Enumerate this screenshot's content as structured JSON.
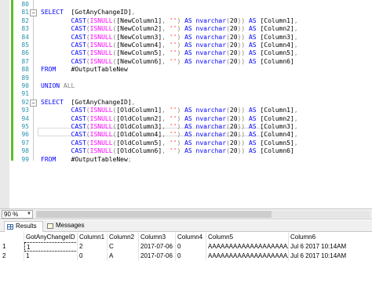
{
  "editor": {
    "lines": [
      {
        "num": "80",
        "tokens": [
          {
            "t": "",
            "c": "tx"
          }
        ]
      },
      {
        "num": "81",
        "tokens": [
          {
            "t": "SELECT  ",
            "c": "kw"
          },
          {
            "t": "[GotAnyChangeID]",
            "c": "tx"
          },
          {
            "t": ",",
            "c": "gr"
          }
        ]
      },
      {
        "num": "82",
        "tokens": [
          {
            "t": "        ",
            "c": "tx"
          },
          {
            "t": "CAST",
            "c": "kw"
          },
          {
            "t": "(",
            "c": "gr"
          },
          {
            "t": "ISNULL",
            "c": "fn"
          },
          {
            "t": "(",
            "c": "gr"
          },
          {
            "t": "[NewColumn1]",
            "c": "tx"
          },
          {
            "t": ", ",
            "c": "gr"
          },
          {
            "t": "''",
            "c": "str"
          },
          {
            "t": ") ",
            "c": "gr"
          },
          {
            "t": "AS nvarchar",
            "c": "kw"
          },
          {
            "t": "(",
            "c": "gr"
          },
          {
            "t": "20",
            "c": "tx"
          },
          {
            "t": ")) ",
            "c": "gr"
          },
          {
            "t": "AS ",
            "c": "kw"
          },
          {
            "t": "[Column1]",
            "c": "tx"
          },
          {
            "t": ",",
            "c": "gr"
          }
        ]
      },
      {
        "num": "83",
        "tokens": [
          {
            "t": "        ",
            "c": "tx"
          },
          {
            "t": "CAST",
            "c": "kw"
          },
          {
            "t": "(",
            "c": "gr"
          },
          {
            "t": "ISNULL",
            "c": "fn"
          },
          {
            "t": "(",
            "c": "gr"
          },
          {
            "t": "[NewColumn2]",
            "c": "tx"
          },
          {
            "t": ", ",
            "c": "gr"
          },
          {
            "t": "''",
            "c": "str"
          },
          {
            "t": ") ",
            "c": "gr"
          },
          {
            "t": "AS nvarchar",
            "c": "kw"
          },
          {
            "t": "(",
            "c": "gr"
          },
          {
            "t": "20",
            "c": "tx"
          },
          {
            "t": ")) ",
            "c": "gr"
          },
          {
            "t": "AS ",
            "c": "kw"
          },
          {
            "t": "[Column2]",
            "c": "tx"
          },
          {
            "t": ",",
            "c": "gr"
          }
        ]
      },
      {
        "num": "84",
        "tokens": [
          {
            "t": "        ",
            "c": "tx"
          },
          {
            "t": "CAST",
            "c": "kw"
          },
          {
            "t": "(",
            "c": "gr"
          },
          {
            "t": "ISNULL",
            "c": "fn"
          },
          {
            "t": "(",
            "c": "gr"
          },
          {
            "t": "[NewColumn3]",
            "c": "tx"
          },
          {
            "t": ", ",
            "c": "gr"
          },
          {
            "t": "''",
            "c": "str"
          },
          {
            "t": ") ",
            "c": "gr"
          },
          {
            "t": "AS nvarchar",
            "c": "kw"
          },
          {
            "t": "(",
            "c": "gr"
          },
          {
            "t": "20",
            "c": "tx"
          },
          {
            "t": ")) ",
            "c": "gr"
          },
          {
            "t": "AS ",
            "c": "kw"
          },
          {
            "t": "[Column3]",
            "c": "tx"
          },
          {
            "t": ",",
            "c": "gr"
          }
        ]
      },
      {
        "num": "85",
        "tokens": [
          {
            "t": "        ",
            "c": "tx"
          },
          {
            "t": "CAST",
            "c": "kw"
          },
          {
            "t": "(",
            "c": "gr"
          },
          {
            "t": "ISNULL",
            "c": "fn"
          },
          {
            "t": "(",
            "c": "gr"
          },
          {
            "t": "[NewColumn4]",
            "c": "tx"
          },
          {
            "t": ", ",
            "c": "gr"
          },
          {
            "t": "''",
            "c": "str"
          },
          {
            "t": ") ",
            "c": "gr"
          },
          {
            "t": "AS nvarchar",
            "c": "kw"
          },
          {
            "t": "(",
            "c": "gr"
          },
          {
            "t": "20",
            "c": "tx"
          },
          {
            "t": ")) ",
            "c": "gr"
          },
          {
            "t": "AS ",
            "c": "kw"
          },
          {
            "t": "[Column4]",
            "c": "tx"
          },
          {
            "t": ",",
            "c": "gr"
          }
        ]
      },
      {
        "num": "86",
        "tokens": [
          {
            "t": "        ",
            "c": "tx"
          },
          {
            "t": "CAST",
            "c": "kw"
          },
          {
            "t": "(",
            "c": "gr"
          },
          {
            "t": "ISNULL",
            "c": "fn"
          },
          {
            "t": "(",
            "c": "gr"
          },
          {
            "t": "[NewColumn5]",
            "c": "tx"
          },
          {
            "t": ", ",
            "c": "gr"
          },
          {
            "t": "''",
            "c": "str"
          },
          {
            "t": ") ",
            "c": "gr"
          },
          {
            "t": "AS nvarchar",
            "c": "kw"
          },
          {
            "t": "(",
            "c": "gr"
          },
          {
            "t": "20",
            "c": "tx"
          },
          {
            "t": ")) ",
            "c": "gr"
          },
          {
            "t": "AS ",
            "c": "kw"
          },
          {
            "t": "[Column5]",
            "c": "tx"
          },
          {
            "t": ",",
            "c": "gr"
          }
        ]
      },
      {
        "num": "87",
        "tokens": [
          {
            "t": "        ",
            "c": "tx"
          },
          {
            "t": "CAST",
            "c": "kw"
          },
          {
            "t": "(",
            "c": "gr"
          },
          {
            "t": "ISNULL",
            "c": "fn"
          },
          {
            "t": "(",
            "c": "gr"
          },
          {
            "t": "[NewColumn6]",
            "c": "tx"
          },
          {
            "t": ", ",
            "c": "gr"
          },
          {
            "t": "''",
            "c": "str"
          },
          {
            "t": ") ",
            "c": "gr"
          },
          {
            "t": "AS nvarchar",
            "c": "kw"
          },
          {
            "t": "(",
            "c": "gr"
          },
          {
            "t": "20",
            "c": "tx"
          },
          {
            "t": ")) ",
            "c": "gr"
          },
          {
            "t": "AS ",
            "c": "kw"
          },
          {
            "t": "[Column6]",
            "c": "tx"
          }
        ]
      },
      {
        "num": "88",
        "tokens": [
          {
            "t": "FROM    ",
            "c": "kw"
          },
          {
            "t": "#OutputTableNew",
            "c": "tx"
          }
        ]
      },
      {
        "num": "89",
        "tokens": [
          {
            "t": "",
            "c": "tx"
          }
        ]
      },
      {
        "num": "90",
        "tokens": [
          {
            "t": "UNION ",
            "c": "kw"
          },
          {
            "t": "ALL",
            "c": "gr"
          }
        ]
      },
      {
        "num": "91",
        "tokens": [
          {
            "t": "",
            "c": "tx"
          }
        ]
      },
      {
        "num": "92",
        "tokens": [
          {
            "t": "SELECT  ",
            "c": "kw"
          },
          {
            "t": "[GotAnyChangeID]",
            "c": "tx"
          },
          {
            "t": ",",
            "c": "gr"
          }
        ]
      },
      {
        "num": "93",
        "tokens": [
          {
            "t": "        ",
            "c": "tx"
          },
          {
            "t": "CAST",
            "c": "kw"
          },
          {
            "t": "(",
            "c": "gr"
          },
          {
            "t": "ISNULL",
            "c": "fn"
          },
          {
            "t": "(",
            "c": "gr"
          },
          {
            "t": "[OldColumn1]",
            "c": "tx"
          },
          {
            "t": ", ",
            "c": "gr"
          },
          {
            "t": "''",
            "c": "str"
          },
          {
            "t": ") ",
            "c": "gr"
          },
          {
            "t": "AS nvarchar",
            "c": "kw"
          },
          {
            "t": "(",
            "c": "gr"
          },
          {
            "t": "20",
            "c": "tx"
          },
          {
            "t": ")) ",
            "c": "gr"
          },
          {
            "t": "AS ",
            "c": "kw"
          },
          {
            "t": "[Column1]",
            "c": "tx"
          },
          {
            "t": ",",
            "c": "gr"
          }
        ]
      },
      {
        "num": "94",
        "tokens": [
          {
            "t": "        ",
            "c": "tx"
          },
          {
            "t": "CAST",
            "c": "kw"
          },
          {
            "t": "(",
            "c": "gr"
          },
          {
            "t": "ISNULL",
            "c": "fn"
          },
          {
            "t": "(",
            "c": "gr"
          },
          {
            "t": "[OldColumn2]",
            "c": "tx"
          },
          {
            "t": ", ",
            "c": "gr"
          },
          {
            "t": "''",
            "c": "str"
          },
          {
            "t": ") ",
            "c": "gr"
          },
          {
            "t": "AS nvarchar",
            "c": "kw"
          },
          {
            "t": "(",
            "c": "gr"
          },
          {
            "t": "20",
            "c": "tx"
          },
          {
            "t": ")) ",
            "c": "gr"
          },
          {
            "t": "AS ",
            "c": "kw"
          },
          {
            "t": "[Column2]",
            "c": "tx"
          },
          {
            "t": ",",
            "c": "gr"
          }
        ]
      },
      {
        "num": "95",
        "tokens": [
          {
            "t": "        ",
            "c": "tx"
          },
          {
            "t": "CAST",
            "c": "kw"
          },
          {
            "t": "(",
            "c": "gr"
          },
          {
            "t": "ISNULL",
            "c": "fn"
          },
          {
            "t": "(",
            "c": "gr"
          },
          {
            "t": "[OldColumn3]",
            "c": "tx"
          },
          {
            "t": ", ",
            "c": "gr"
          },
          {
            "t": "''",
            "c": "str"
          },
          {
            "t": ") ",
            "c": "gr"
          },
          {
            "t": "AS nvarchar",
            "c": "kw"
          },
          {
            "t": "(",
            "c": "gr"
          },
          {
            "t": "20",
            "c": "tx"
          },
          {
            "t": ")) ",
            "c": "gr"
          },
          {
            "t": "AS ",
            "c": "kw"
          },
          {
            "t": "[Column3]",
            "c": "tx"
          },
          {
            "t": ",",
            "c": "gr"
          }
        ]
      },
      {
        "num": "96",
        "tokens": [
          {
            "t": "        ",
            "c": "tx"
          },
          {
            "t": "CAST",
            "c": "kw"
          },
          {
            "t": "(",
            "c": "gr"
          },
          {
            "t": "ISNULL",
            "c": "fn"
          },
          {
            "t": "(",
            "c": "gr"
          },
          {
            "t": "[OldColumn4]",
            "c": "tx"
          },
          {
            "t": ", ",
            "c": "gr"
          },
          {
            "t": "''",
            "c": "str"
          },
          {
            "t": ") ",
            "c": "gr"
          },
          {
            "t": "AS nvarchar",
            "c": "kw"
          },
          {
            "t": "(",
            "c": "gr"
          },
          {
            "t": "20",
            "c": "tx"
          },
          {
            "t": ")) ",
            "c": "gr"
          },
          {
            "t": "AS ",
            "c": "kw"
          },
          {
            "t": "[Column4]",
            "c": "tx"
          },
          {
            "t": ",",
            "c": "gr"
          }
        ]
      },
      {
        "num": "97",
        "tokens": [
          {
            "t": "        ",
            "c": "tx"
          },
          {
            "t": "CAST",
            "c": "kw"
          },
          {
            "t": "(",
            "c": "gr"
          },
          {
            "t": "ISNULL",
            "c": "fn"
          },
          {
            "t": "(",
            "c": "gr"
          },
          {
            "t": "[OldColumn5]",
            "c": "tx"
          },
          {
            "t": ", ",
            "c": "gr"
          },
          {
            "t": "''",
            "c": "str"
          },
          {
            "t": ") ",
            "c": "gr"
          },
          {
            "t": "AS nvarchar",
            "c": "kw"
          },
          {
            "t": "(",
            "c": "gr"
          },
          {
            "t": "20",
            "c": "tx"
          },
          {
            "t": ")) ",
            "c": "gr"
          },
          {
            "t": "AS ",
            "c": "kw"
          },
          {
            "t": "[Column5]",
            "c": "tx"
          },
          {
            "t": ",",
            "c": "gr"
          }
        ]
      },
      {
        "num": "98",
        "tokens": [
          {
            "t": "        ",
            "c": "tx"
          },
          {
            "t": "CAST",
            "c": "kw"
          },
          {
            "t": "(",
            "c": "gr"
          },
          {
            "t": "ISNULL",
            "c": "fn"
          },
          {
            "t": "(",
            "c": "gr"
          },
          {
            "t": "[OldColumn6]",
            "c": "tx"
          },
          {
            "t": ", ",
            "c": "gr"
          },
          {
            "t": "''",
            "c": "str"
          },
          {
            "t": ") ",
            "c": "gr"
          },
          {
            "t": "AS nvarchar",
            "c": "kw"
          },
          {
            "t": "(",
            "c": "gr"
          },
          {
            "t": "20",
            "c": "tx"
          },
          {
            "t": ")) ",
            "c": "gr"
          },
          {
            "t": "AS ",
            "c": "kw"
          },
          {
            "t": "[Column6]",
            "c": "tx"
          }
        ]
      },
      {
        "num": "99",
        "tokens": [
          {
            "t": "FROM    ",
            "c": "kw"
          },
          {
            "t": "#OutputTableNew",
            "c": "tx"
          },
          {
            "t": ";",
            "c": "gr"
          }
        ]
      }
    ],
    "fold_markers": [
      "−",
      "−"
    ],
    "colors": {
      "keyword": "#0000ff",
      "function": "#ff00ff",
      "string": "#ff0000",
      "operator": "#808080",
      "line_number": "#2b91af",
      "change_bar": "#5cbf2a"
    }
  },
  "status": {
    "zoom": "90 %",
    "zoom_dropdown_icon": "chevron-down-icon"
  },
  "results": {
    "tabs": [
      {
        "label": "Results",
        "icon": "grid-icon"
      },
      {
        "label": "Messages",
        "icon": "message-icon"
      }
    ],
    "columns": [
      "GotAnyChangeID",
      "Column1",
      "Column2",
      "Column3",
      "Column4",
      "Column5",
      "Column6"
    ],
    "rows": [
      {
        "num": "1",
        "cells": [
          "1",
          "2",
          "C",
          "2017-07-06",
          "0",
          "AAAAAAAAAAAAAAAAAAAA",
          "Jul  6 2017 10:14AM"
        ]
      },
      {
        "num": "2",
        "cells": [
          "1",
          "0",
          "A",
          "2017-07-06",
          "0",
          "AAAAAAAAAAAAAAAAAAAA",
          "Jul  6 2017 10:14AM"
        ]
      }
    ]
  }
}
